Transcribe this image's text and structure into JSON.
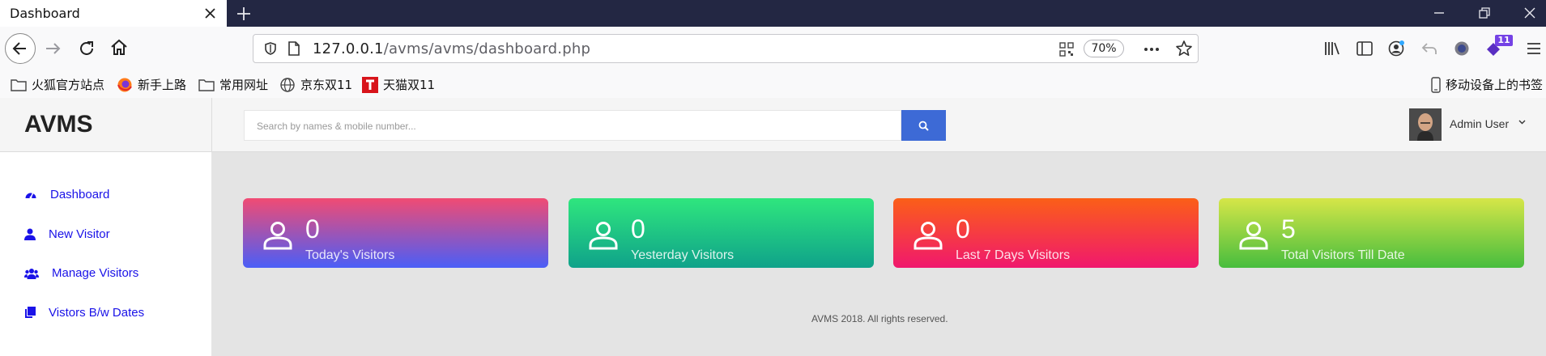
{
  "browser": {
    "tab_title": "Dashboard",
    "url_host": "127.0.0.1",
    "url_path": "/avms/avms/dashboard.php",
    "zoom": "70%",
    "extension_badge": "11",
    "bookmarks": [
      {
        "label": "火狐官方站点",
        "icon": "folder-icon"
      },
      {
        "label": "新手上路",
        "icon": "firefox-icon"
      },
      {
        "label": "常用网址",
        "icon": "folder-icon"
      },
      {
        "label": "京东双11",
        "icon": "globe-icon"
      },
      {
        "label": "天猫双11",
        "icon": "tmall-icon"
      }
    ],
    "mobile_bookmarks": "移动设备上的书签"
  },
  "app": {
    "logo": "AVMS",
    "search_placeholder": "Search by names & mobile number...",
    "user_name": "Admin User",
    "sidebar": [
      {
        "label": "Dashboard",
        "icon": "dashboard-icon"
      },
      {
        "label": "New Visitor",
        "icon": "user-icon"
      },
      {
        "label": "Manage Visitors",
        "icon": "users-icon"
      },
      {
        "label": "Vistors B/w Dates",
        "icon": "copy-icon"
      }
    ],
    "cards": [
      {
        "value": "0",
        "label": "Today's Visitors",
        "colors": [
          "#f14b73",
          "#4a5ef7"
        ]
      },
      {
        "value": "0",
        "label": "Yesterday Visitors",
        "colors": [
          "#2fe67e",
          "#0fa28a"
        ]
      },
      {
        "value": "0",
        "label": "Last 7 Days Visitors",
        "colors": [
          "#fb5f17",
          "#f0186d"
        ]
      },
      {
        "value": "5",
        "label": "Total Visitors Till Date",
        "colors": [
          "#d6e648",
          "#47bd3e"
        ]
      }
    ],
    "footer": "AVMS 2018. All rights reserved.",
    "accent_color": "#3d6ad6",
    "link_color": "#1a12e8"
  }
}
